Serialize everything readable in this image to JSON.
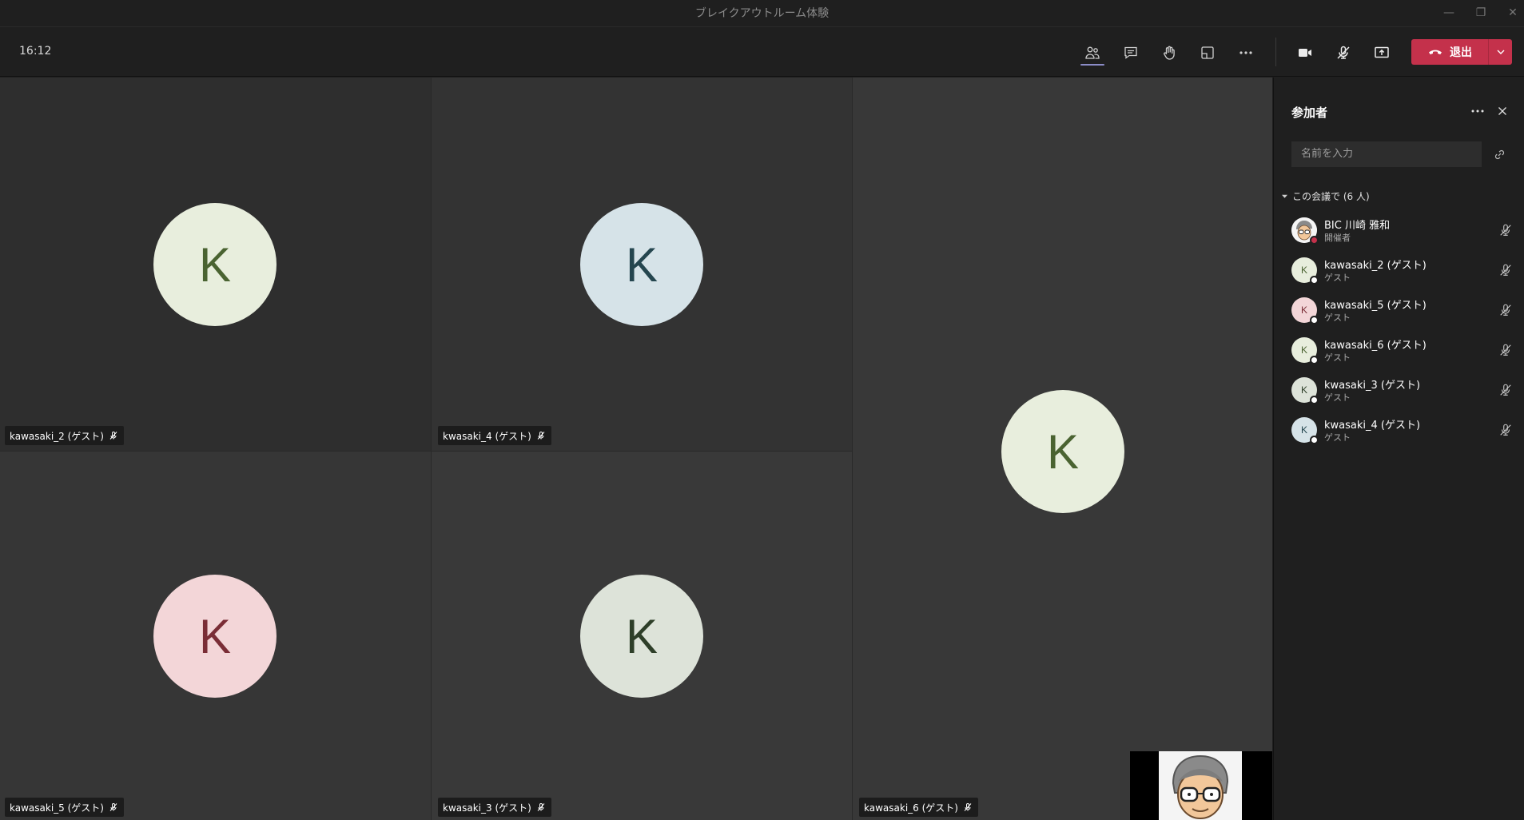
{
  "window": {
    "title": "ブレイクアウトルーム体験",
    "controls": {
      "minimize": "—",
      "restore": "❐",
      "close": "✕"
    }
  },
  "toolbar": {
    "clock": "16:12",
    "buttons": [
      {
        "icon": "people-icon",
        "active": true
      },
      {
        "icon": "chat-icon"
      },
      {
        "icon": "raise-hand-icon"
      },
      {
        "icon": "breakout-rooms-icon"
      },
      {
        "icon": "more-options-icon"
      },
      {
        "icon": "camera-icon"
      },
      {
        "icon": "mic-off-icon"
      },
      {
        "icon": "share-screen-icon"
      }
    ],
    "leave_label": "退出",
    "leave_color": "#c4314b"
  },
  "tiles": [
    {
      "name": "kawasaki_2 (ゲスト)",
      "initial": "K",
      "avatar_bg": "#e8eedd",
      "avatar_fg": "#4a6331"
    },
    {
      "name": "kwasaki_4 (ゲスト)",
      "initial": "K",
      "avatar_bg": "#d6e3e8",
      "avatar_fg": "#25464f"
    },
    {
      "name": "kawasaki_6 (ゲスト)",
      "initial": "K",
      "avatar_bg": "#e8eedd",
      "avatar_fg": "#4a6331"
    },
    {
      "name": "kawasaki_5 (ゲスト)",
      "initial": "K",
      "avatar_bg": "#f3d6d8",
      "avatar_fg": "#7a2d36"
    },
    {
      "name": "kwasaki_3 (ゲスト)",
      "initial": "K",
      "avatar_bg": "#dde3d9",
      "avatar_fg": "#2e3f29"
    }
  ],
  "panel": {
    "title": "参加者",
    "search_placeholder": "名前を入力",
    "section_label": "この会議で (6 人)",
    "participants": [
      {
        "name": "BIC 川崎 雅和",
        "role": "開催者",
        "initial": "",
        "avatar_bg": "#f0f0f0",
        "avatar_fg": "#555",
        "status_color": "#c4314b",
        "photo": true
      },
      {
        "name": "kawasaki_2 (ゲスト)",
        "role": "ゲスト",
        "initial": "K",
        "avatar_bg": "#e8eedd",
        "avatar_fg": "#4a6331",
        "status_color": "#ffffff"
      },
      {
        "name": "kawasaki_5 (ゲスト)",
        "role": "ゲスト",
        "initial": "K",
        "avatar_bg": "#f3d6d8",
        "avatar_fg": "#7a2d36",
        "status_color": "#ffffff"
      },
      {
        "name": "kawasaki_6 (ゲスト)",
        "role": "ゲスト",
        "initial": "K",
        "avatar_bg": "#e8eedd",
        "avatar_fg": "#4a6331",
        "status_color": "#ffffff"
      },
      {
        "name": "kwasaki_3 (ゲスト)",
        "role": "ゲスト",
        "initial": "K",
        "avatar_bg": "#dde3d9",
        "avatar_fg": "#2e3f29",
        "status_color": "#ffffff"
      },
      {
        "name": "kwasaki_4 (ゲスト)",
        "role": "ゲスト",
        "initial": "K",
        "avatar_bg": "#d6e3e8",
        "avatar_fg": "#25464f",
        "status_color": "#ffffff"
      }
    ]
  }
}
